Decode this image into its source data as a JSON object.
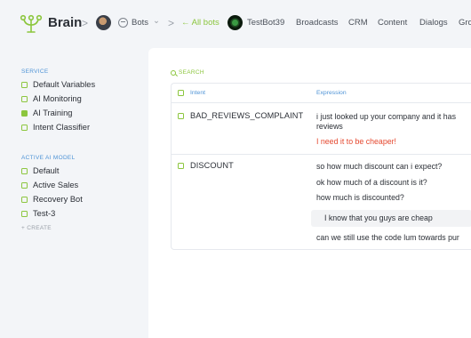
{
  "header": {
    "brand": "Brain",
    "separator": ">",
    "bots_label": "Bots",
    "bots_caret": "⌄",
    "back_link": "← All bots",
    "bot_name": "TestBot39",
    "nav_links": [
      "Broadcasts",
      "CRM",
      "Content",
      "Dialogs",
      "Gro"
    ]
  },
  "sidebar": {
    "service_title": "SERVICE",
    "service_items": [
      {
        "label": "Default Variables",
        "active": false
      },
      {
        "label": "AI Monitoring",
        "active": false
      },
      {
        "label": "AI Training",
        "active": true
      },
      {
        "label": "Intent Classifier",
        "active": false
      }
    ],
    "model_title": "ACTIVE AI MODEL",
    "model_items": [
      {
        "label": "Default"
      },
      {
        "label": "Active Sales"
      },
      {
        "label": "Recovery Bot"
      },
      {
        "label": "Test-3"
      }
    ],
    "create_label": "+ CREATE"
  },
  "main": {
    "search_label": "SEARCH",
    "columns": [
      "Intent",
      "Expression"
    ],
    "rows": [
      {
        "intent": "BAD_REVIEWS_COMPLAINT",
        "expressions": [
          {
            "text": "i just looked up your company and it has",
            "style": "normal"
          },
          {
            "text": "reviews",
            "style": "normal"
          },
          {
            "text": "I need it to be cheaper!",
            "style": "red"
          }
        ]
      },
      {
        "intent": "DISCOUNT",
        "expressions": [
          {
            "text": "so how much discount can i expect?",
            "style": "normal"
          },
          {
            "text": "ok how much of a discount is it?",
            "style": "normal"
          },
          {
            "text": "how much is discounted?",
            "style": "normal"
          },
          {
            "text": "I know that you guys are cheap",
            "style": "highlight"
          },
          {
            "text": "can we still use the code lum towards pur",
            "style": "normal"
          }
        ]
      }
    ]
  },
  "colors": {
    "accent_green": "#8cc63e",
    "accent_blue": "#4e93d6",
    "error_red": "#e5482f"
  },
  "icons": {
    "logo": "brain-logo-icon",
    "search": "search-icon",
    "bots": "bot-icon"
  }
}
